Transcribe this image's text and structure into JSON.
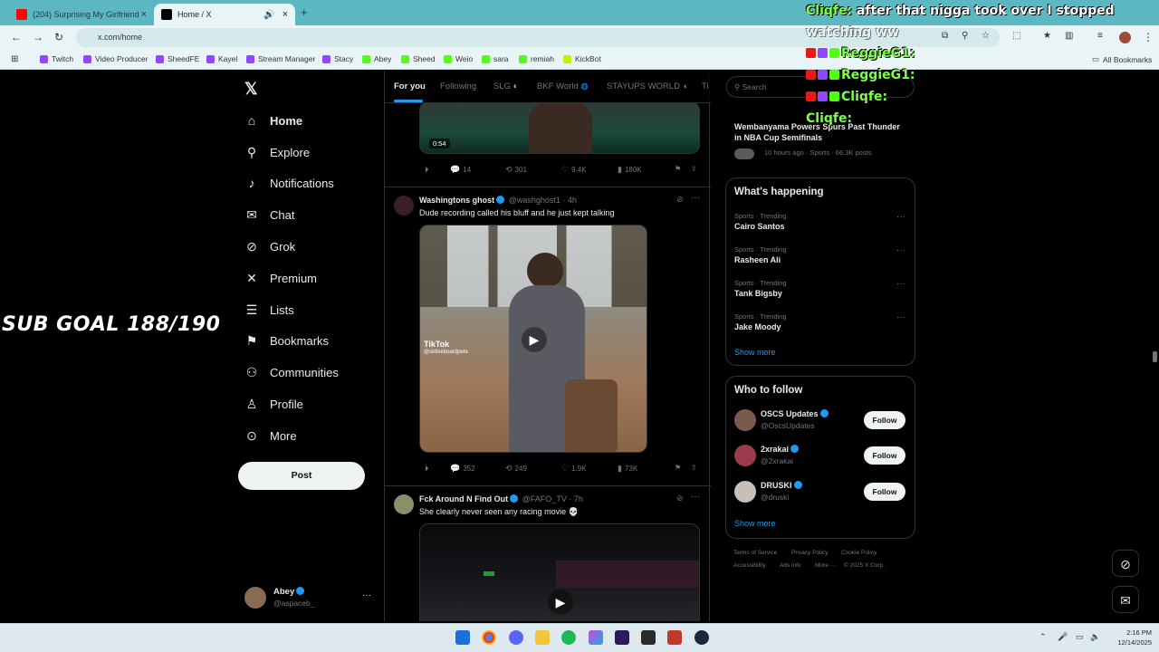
{
  "browser": {
    "tabs": [
      {
        "title": "(204) Surprising My Girlfriend",
        "favicon_color": "#ff0000"
      },
      {
        "title": "Home / X",
        "favicon_color": "#000000"
      }
    ],
    "address": "x.com/home",
    "bookmarks": [
      {
        "label": "Twitch",
        "color": "#9146ff"
      },
      {
        "label": "Video Producer",
        "color": "#9146ff"
      },
      {
        "label": "SheedFE",
        "color": "#9146ff"
      },
      {
        "label": "Kayel",
        "color": "#9146ff"
      },
      {
        "label": "Stream Manager",
        "color": "#9146ff"
      },
      {
        "label": "Stacy",
        "color": "#9146ff"
      },
      {
        "label": "Abey",
        "color": "#53fc18"
      },
      {
        "label": "Sheed",
        "color": "#53fc18"
      },
      {
        "label": "Weio",
        "color": "#53fc18"
      },
      {
        "label": "sara",
        "color": "#53fc18"
      },
      {
        "label": "remiah",
        "color": "#53fc18"
      },
      {
        "label": "KickBot",
        "color": "#c8f000"
      }
    ],
    "all_bookmarks": "All Bookmarks"
  },
  "sidebar": {
    "items": [
      {
        "label": "Home",
        "icon": "home-icon",
        "glyph": "⌂"
      },
      {
        "label": "Explore",
        "icon": "search-icon",
        "glyph": "⚲"
      },
      {
        "label": "Notifications",
        "icon": "bell-icon",
        "glyph": "🔔"
      },
      {
        "label": "Chat",
        "icon": "mail-icon",
        "glyph": "✉"
      },
      {
        "label": "Grok",
        "icon": "grok-icon",
        "glyph": "⊘"
      },
      {
        "label": "Premium",
        "icon": "x-icon",
        "glyph": "✕"
      },
      {
        "label": "Lists",
        "icon": "list-icon",
        "glyph": "☰"
      },
      {
        "label": "Bookmarks",
        "icon": "bookmark-icon",
        "glyph": "⚑"
      },
      {
        "label": "Communities",
        "icon": "communities-icon",
        "glyph": "👥"
      },
      {
        "label": "Profile",
        "icon": "profile-icon",
        "glyph": "👤"
      },
      {
        "label": "More",
        "icon": "more-icon",
        "glyph": "⋯"
      }
    ],
    "post_label": "Post",
    "account": {
      "name": "Abey",
      "handle": "@aspaceb_"
    }
  },
  "feed": {
    "tabs": [
      "For you",
      "Following",
      "SLG",
      "BKF World",
      "STAYUPS WORLD",
      "Ti"
    ],
    "top_post": {
      "duration": "0:54",
      "stats": {
        "replies": "14",
        "reposts": "301",
        "likes": "9.4K",
        "views": "180K"
      }
    },
    "post1": {
      "name": "Washingtons ghost",
      "handle": "@washghost1 · 4h",
      "text": "Dude recording called his bluff and he just kept talking",
      "watermark": "TikTok",
      "watermark_handle": "@sk8seboardpete",
      "stats": {
        "replies": "352",
        "reposts": "249",
        "likes": "1.9K",
        "views": "73K"
      }
    },
    "post2": {
      "name": "Fck Around N Find Out",
      "handle": "@FAFO_TV · 7h",
      "text": "She clearly never seen any racing movie 💀"
    }
  },
  "right": {
    "search_placeholder": "Search",
    "news": {
      "title": "Wembanyama Powers Spurs Past Thunder in NBA Cup Semifinals",
      "meta": "10 hours ago · Sports · 66.3K posts"
    },
    "happening": {
      "title": "What's happening",
      "trends": [
        {
          "meta": "Sports · Trending",
          "name": "Cairo Santos"
        },
        {
          "meta": "Sports · Trending",
          "name": "Rasheen Ali"
        },
        {
          "meta": "Sports · Trending",
          "name": "Tank Bigsby"
        },
        {
          "meta": "Sports · Trending",
          "name": "Jake Moody"
        }
      ],
      "show_more": "Show more"
    },
    "who_to_follow": {
      "title": "Who to follow",
      "accounts": [
        {
          "name": "OSCS Updates",
          "handle": "@OscsUpdates",
          "button": "Follow"
        },
        {
          "name": "2xrakai",
          "handle": "@2xrakai",
          "button": "Follow"
        },
        {
          "name": "DRUSKI",
          "handle": "@druski",
          "button": "Follow"
        }
      ],
      "show_more": "Show more"
    },
    "footer": [
      "Terms of Service",
      "Privacy Policy",
      "Cookie Policy",
      "Accessibility",
      "Ads info",
      "More ···",
      "© 2025 X Corp."
    ]
  },
  "overlay": {
    "sub_goal": "SUB GOAL 188/190",
    "chat": [
      {
        "name": "Cliqfe:",
        "text": "after that nigga took over I stopped"
      },
      {
        "name": "",
        "text": "watching ww"
      },
      {
        "name": "ReggieG1:",
        "text": ""
      },
      {
        "name": "ReggieG1:",
        "text": ""
      },
      {
        "name": "Cliqfe:",
        "text": ""
      }
    ]
  },
  "taskbar": {
    "time": "2:16 PM",
    "date": "12/14/2025"
  }
}
